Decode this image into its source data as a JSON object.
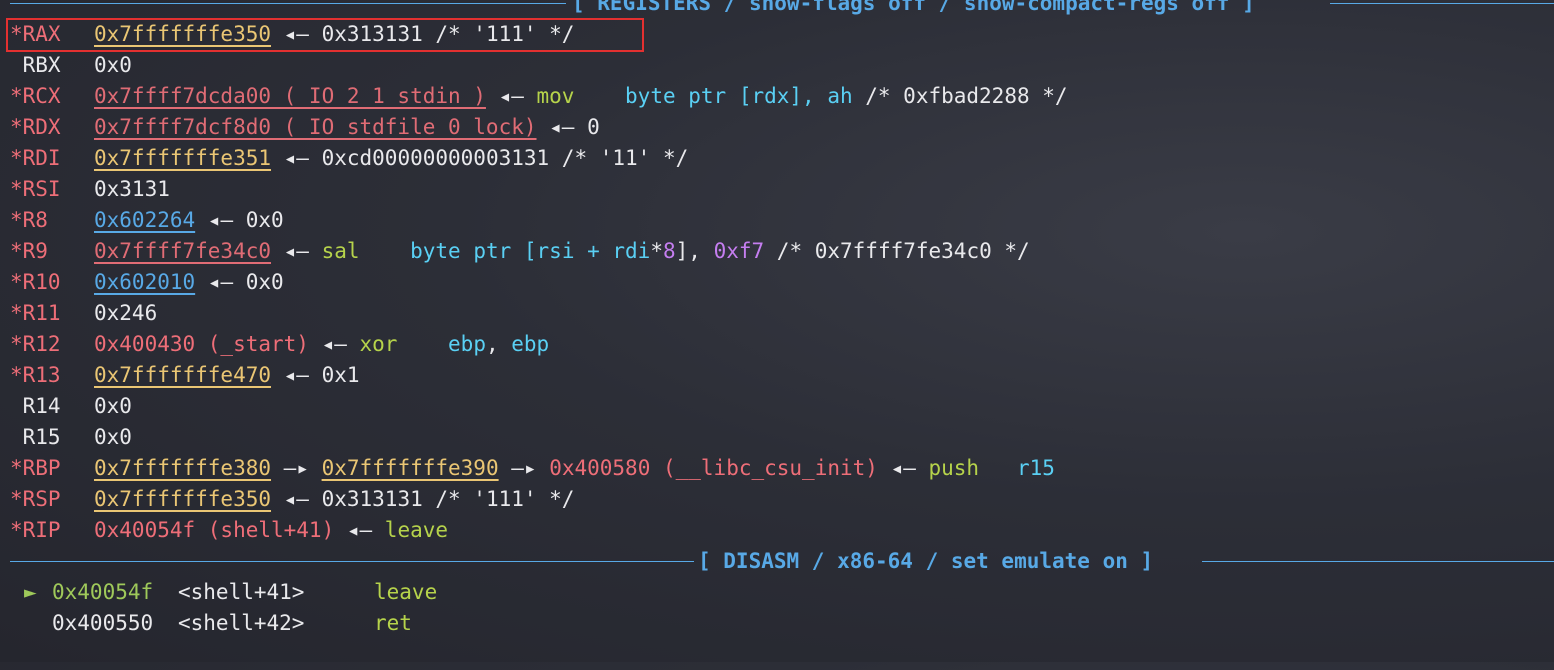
{
  "headers": {
    "registers": "[ REGISTERS / show-flags off / show-compact-regs off ]",
    "disasm": "[ DISASM / x86-64 / set emulate on ]"
  },
  "registers": [
    {
      "name": "*RAX",
      "changed": true,
      "parts": [
        [
          "stk",
          "0x7fffffffe350"
        ],
        [
          "plain",
          " ◂— 0x313131 /* '111' */"
        ]
      ]
    },
    {
      "name": "RBX",
      "changed": false,
      "parts": [
        [
          "plain",
          "0x0"
        ]
      ]
    },
    {
      "name": "*RCX",
      "changed": true,
      "parts": [
        [
          "data",
          "0x7ffff7dcda00 (_IO_2_1_stdin_)"
        ],
        [
          "plain",
          " ◂— "
        ],
        [
          "mnem",
          "mov"
        ],
        [
          "plain",
          "    "
        ],
        [
          "op",
          "byte ptr [rdx], ah"
        ],
        [
          "plain",
          " /* 0xfbad2288 */"
        ]
      ]
    },
    {
      "name": "*RDX",
      "changed": true,
      "parts": [
        [
          "data",
          "0x7ffff7dcf8d0 (_IO_stdfile_0_lock)"
        ],
        [
          "plain",
          " ◂— 0"
        ]
      ]
    },
    {
      "name": "*RDI",
      "changed": true,
      "parts": [
        [
          "stk",
          "0x7fffffffe351"
        ],
        [
          "plain",
          " ◂— 0xcd00000000003131 /* '11' */"
        ]
      ]
    },
    {
      "name": "*RSI",
      "changed": true,
      "parts": [
        [
          "plain",
          "0x3131"
        ]
      ]
    },
    {
      "name": "*R8",
      "changed": true,
      "parts": [
        [
          "heap",
          "0x602264"
        ],
        [
          "plain",
          " ◂— 0x0"
        ]
      ]
    },
    {
      "name": "*R9",
      "changed": true,
      "parts": [
        [
          "data",
          "0x7ffff7fe34c0"
        ],
        [
          "plain",
          " ◂— "
        ],
        [
          "mnem",
          "sal"
        ],
        [
          "plain",
          "    "
        ],
        [
          "op",
          "byte ptr [rsi + rdi"
        ],
        [
          "plain",
          "*"
        ],
        [
          "imm",
          "8"
        ],
        [
          "plain",
          "], "
        ],
        [
          "imm",
          "0xf7"
        ],
        [
          "plain",
          " /* 0x7ffff7fe34c0 */"
        ]
      ]
    },
    {
      "name": "*R10",
      "changed": true,
      "parts": [
        [
          "heap",
          "0x602010"
        ],
        [
          "plain",
          " ◂— 0x0"
        ]
      ]
    },
    {
      "name": "*R11",
      "changed": true,
      "parts": [
        [
          "plain",
          "0x246"
        ]
      ]
    },
    {
      "name": "*R12",
      "changed": true,
      "parts": [
        [
          "code",
          "0x400430 (_start)"
        ],
        [
          "plain",
          " ◂— "
        ],
        [
          "mnem",
          "xor"
        ],
        [
          "plain",
          "    "
        ],
        [
          "op",
          "ebp"
        ],
        [
          "plain",
          ", "
        ],
        [
          "op",
          "ebp"
        ]
      ]
    },
    {
      "name": "*R13",
      "changed": true,
      "parts": [
        [
          "stk",
          "0x7fffffffe470"
        ],
        [
          "plain",
          " ◂— 0x1"
        ]
      ]
    },
    {
      "name": "R14",
      "changed": false,
      "parts": [
        [
          "plain",
          "0x0"
        ]
      ]
    },
    {
      "name": "R15",
      "changed": false,
      "parts": [
        [
          "plain",
          "0x0"
        ]
      ]
    },
    {
      "name": "*RBP",
      "changed": true,
      "parts": [
        [
          "stk",
          "0x7fffffffe380"
        ],
        [
          "plain",
          " —▸ "
        ],
        [
          "stk",
          "0x7fffffffe390"
        ],
        [
          "plain",
          " —▸ "
        ],
        [
          "code",
          "0x400580 (__libc_csu_init)"
        ],
        [
          "plain",
          " ◂— "
        ],
        [
          "mnem",
          "push"
        ],
        [
          "plain",
          "   "
        ],
        [
          "op",
          "r15"
        ]
      ]
    },
    {
      "name": "*RSP",
      "changed": true,
      "parts": [
        [
          "stk",
          "0x7fffffffe350"
        ],
        [
          "plain",
          " ◂— 0x313131 /* '111' */"
        ]
      ]
    },
    {
      "name": "*RIP",
      "changed": true,
      "parts": [
        [
          "code",
          "0x40054f (shell+41)"
        ],
        [
          "plain",
          " ◂— "
        ],
        [
          "mnem",
          "leave"
        ]
      ]
    }
  ],
  "disasm": [
    {
      "current": true,
      "marker": "►",
      "addr": "0x40054f",
      "sym": "<shell+41>",
      "mnem": "leave"
    },
    {
      "current": false,
      "marker": "",
      "addr": "0x400550",
      "sym": "<shell+42>",
      "mnem": "ret"
    }
  ],
  "colors": {
    "header": "#58a9e6",
    "changed_reg": "#ee6e78",
    "stack": "#eac674",
    "code": "#ee6e78",
    "heap": "#58a9e6",
    "mnemonic": "#b6d34b",
    "operand": "#5ad0f4",
    "immediate": "#c57ef0",
    "highlight_box": "#e33030"
  }
}
